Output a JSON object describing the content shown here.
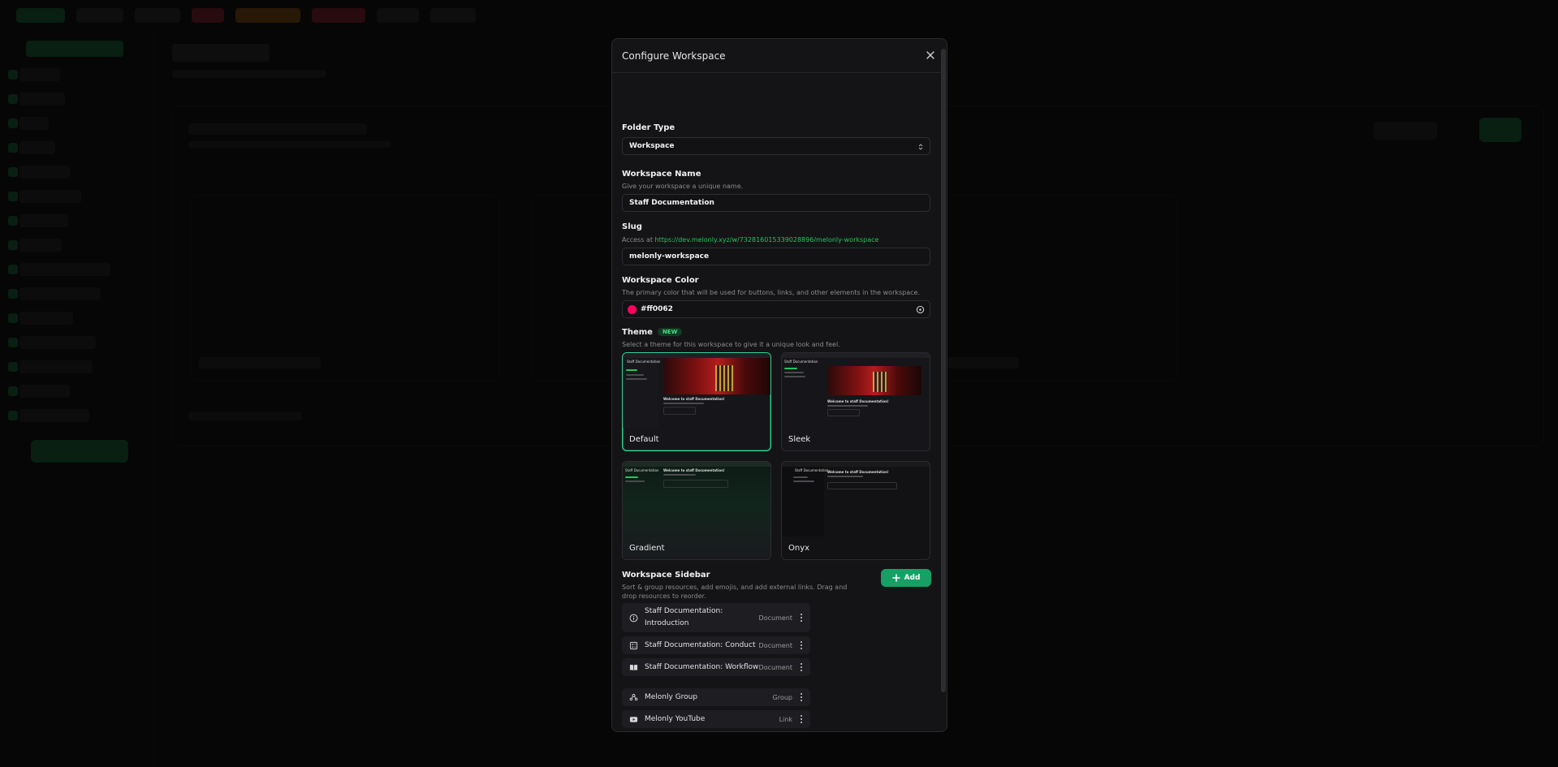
{
  "modal": {
    "title": "Configure Workspace",
    "folder_type": {
      "label": "Folder Type",
      "value": "Workspace"
    },
    "workspace_name": {
      "label": "Workspace Name",
      "help": "Give your workspace a unique name.",
      "value": "Staff Documentation"
    },
    "slug": {
      "label": "Slug",
      "help_prefix": "Access at",
      "url": "https://dev.melonly.xyz/w/732816015339028896/melonly-workspace",
      "value": "melonly-workspace"
    },
    "workspace_color": {
      "label": "Workspace Color",
      "help": "The primary color that will be used for buttons, links, and other elements in the workspace.",
      "value": "#ff0062",
      "swatch": "#ff0062"
    },
    "theme": {
      "label": "Theme",
      "badge": "NEW",
      "help": "Select a theme for this workspace to give it a unique look and feel.",
      "options": [
        {
          "name": "Default",
          "selected": true
        },
        {
          "name": "Sleek",
          "selected": false
        },
        {
          "name": "Gradient",
          "selected": false
        },
        {
          "name": "Onyx",
          "selected": false
        }
      ],
      "preview_title": "Welcome to staff Documentation!",
      "preview_sidebar_title": "Staff Documentation"
    },
    "sidebar": {
      "label": "Workspace Sidebar",
      "help": "Sort & group resources, add emojis, and add external links. Drag and drop resources to reorder.",
      "add_label": "Add",
      "items": [
        {
          "icon": "info-circle-icon",
          "name": "Staff Documentation: Introduction",
          "type": "Document"
        },
        {
          "icon": "rules-icon",
          "name": "Staff Documentation: Conduct",
          "type": "Document"
        },
        {
          "icon": "book-icon",
          "name": "Staff Documentation: Workflow",
          "type": "Document"
        },
        {
          "icon": "group-icon",
          "name": "Melonly Group",
          "type": "Group"
        },
        {
          "icon": "youtube-icon",
          "name": "Melonly YouTube",
          "type": "Link"
        }
      ]
    }
  },
  "colors": {
    "accent": "#16a065",
    "selected_border": "#34d399",
    "link": "#22c55e",
    "background": "#060606",
    "modal": "#141416"
  }
}
